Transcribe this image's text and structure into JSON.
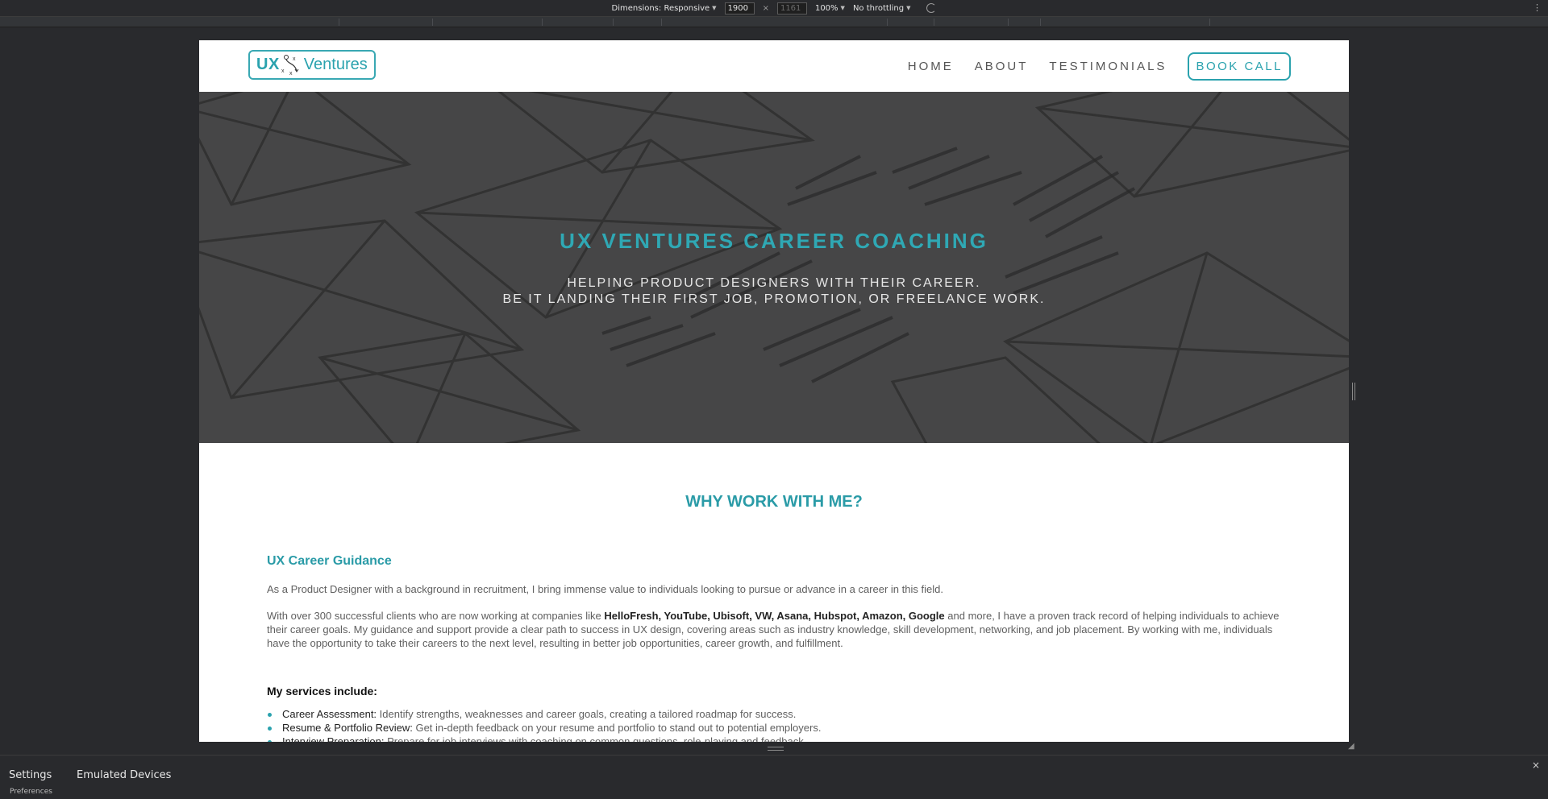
{
  "devtools": {
    "dimensions_label": "Dimensions: Responsive",
    "width_value": "1900",
    "height_value": "1161",
    "zoom_label": "100%",
    "throttle_label": "No throttling"
  },
  "site": {
    "logo": {
      "ux": "UX",
      "name": "Ventures"
    },
    "nav": {
      "home": "HOME",
      "about": "ABOUT",
      "testimonials": "TESTIMONIALS",
      "book_call": "BOOK CALL"
    },
    "hero": {
      "title": "UX VENTURES CAREER COACHING",
      "sub_line1": "HELPING PRODUCT DESIGNERS WITH THEIR CAREER.",
      "sub_line2": "BE IT LANDING THEIR FIRST JOB, PROMOTION, OR FREELANCE WORK."
    },
    "why_heading": "WHY WORK WITH ME?",
    "guidance": {
      "heading": "UX Career Guidance",
      "p1": "As a Product Designer with a background in recruitment, I bring immense value to individuals looking to pursue or advance in a career in this field.",
      "p2_start": "With over 300 successful clients who are now working at companies like ",
      "p2_companies": "HelloFresh, YouTube, Ubisoft, VW, Asana, Hubspot, Amazon, Google",
      "p2_end": " and more, I have a proven track record of helping individuals to achieve their career goals. My guidance and support provide a clear path to success in UX design, covering areas such as industry knowledge, skill development, networking, and job placement. By working with me, individuals have the opportunity to take their careers to the next level, resulting in better job opportunities, career growth, and fulfillment."
    },
    "services": {
      "heading": "My services include:",
      "items": [
        {
          "label": "Career Assessment:",
          "text": " Identify strengths, weaknesses and career goals, creating a tailored roadmap for success."
        },
        {
          "label": "Resume & Portfolio Review:",
          "text": " Get in-depth feedback on your resume and portfolio to stand out to potential employers."
        },
        {
          "label": "Interview Preparation:",
          "text": " Prepare for job interviews with coaching on common questions, role-playing and feedback."
        }
      ]
    }
  },
  "drawer": {
    "tab_settings": "Settings",
    "tab_devices": "Emulated Devices",
    "sub_label": "Preferences"
  }
}
